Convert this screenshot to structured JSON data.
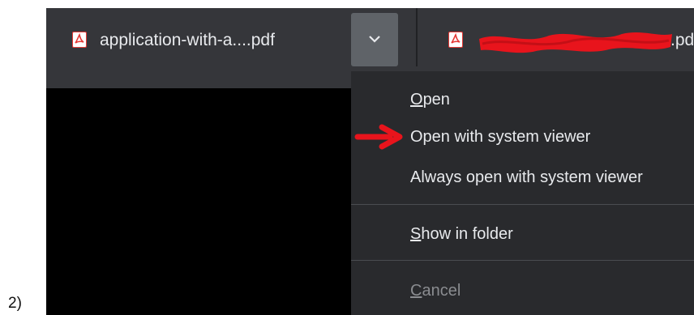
{
  "step_label": "2)",
  "download_bar": {
    "items": [
      {
        "name": "application-with-a....pdf",
        "icon": "pdf-file-icon"
      },
      {
        "name_tail": ".pd",
        "icon": "pdf-file-icon",
        "name_redacted": true
      }
    ],
    "menu_button_icon": "chevron-down-icon"
  },
  "menu": {
    "items": [
      {
        "mnemonic": "O",
        "rest": "pen",
        "enabled": true
      },
      {
        "label": "Open with system viewer",
        "enabled": true,
        "highlighted_by_arrow": true
      },
      {
        "label": "Always open with system viewer",
        "enabled": true
      },
      {
        "mnemonic": "S",
        "rest": "how in folder",
        "enabled": true
      },
      {
        "mnemonic": "C",
        "rest": "ancel",
        "enabled": false
      }
    ]
  },
  "annotation": {
    "icon": "red-arrow-icon",
    "color": "#e8141c"
  },
  "colors": {
    "bar": "#35363a",
    "menu": "#292a2d",
    "text": "#e8eaed",
    "disabled_text": "#8a8c90",
    "chevron_button": "#5f6368"
  }
}
